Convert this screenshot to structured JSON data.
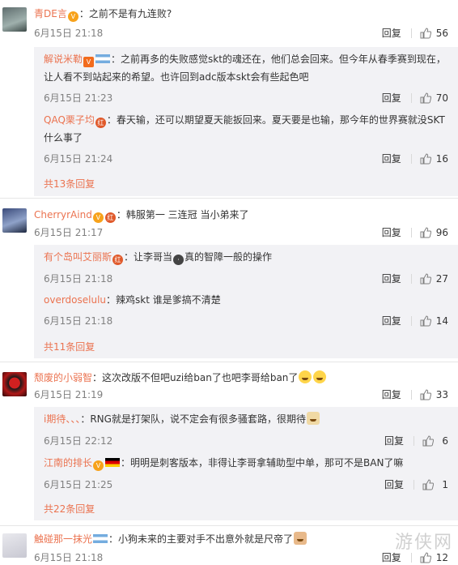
{
  "threads": [
    {
      "user": "青DE言",
      "text": "：之前不是有九连败?",
      "time": "6月15日 21:18",
      "reply_label": "回复",
      "likes": "56",
      "subs": [
        {
          "user": "解说米勒",
          "text": "：之前再多的失败感觉skt的魂还在，他们总会回来。但今年从春季赛到现在，让人看不到站起来的希望。也许回到adc版本skt会有些起色吧",
          "time": "6月15日 21:23",
          "likes": "70"
        },
        {
          "user": "QAQ栗子均",
          "text": "：春天输，还可以期望夏天能扳回来。夏天要是也输，那今年的世界赛就没SKT什么事了",
          "time": "6月15日 21:24",
          "likes": "16"
        }
      ],
      "more": "共13条回复"
    },
    {
      "user": "CherryrAind",
      "text": "：韩服第一 三连冠 当小弟来了",
      "time": "6月15日 21:17",
      "reply_label": "回复",
      "likes": "96",
      "subs": [
        {
          "user": "有个岛叫艾丽斯",
          "text": "：让李哥当",
          "text2": "真的智障一般的操作",
          "time": "6月15日 21:18",
          "likes": "27"
        },
        {
          "user": "overdoselulu",
          "text": "：辣鸡skt 谁是爹搞不清楚",
          "time": "6月15日 21:18",
          "likes": "14"
        }
      ],
      "more": "共11条回复"
    },
    {
      "user": "颓废的小弱智",
      "text": "：这次改版不但吧uzi给ban了也吧李哥给ban了",
      "time": "6月15日 21:19",
      "reply_label": "回复",
      "likes": "33",
      "subs": [
        {
          "user": "i期待、、、",
          "text": "：RNG就是打架队，说不定会有很多骚套路，很期待",
          "time": "6月15日 22:12",
          "likes": "6"
        },
        {
          "user": "江南的排长",
          "text": "：明明是刺客版本，非得让李哥拿辅助型中单，那可不是BAN了嘛",
          "time": "6月15日 21:25",
          "likes": "1"
        }
      ],
      "more": "共22条回复"
    },
    {
      "user": "触碰那一抹光",
      "text": "：小狗未来的主要对手不出意外就是尺帝了",
      "time": "6月15日 21:18",
      "reply_label": "回复",
      "likes": "12",
      "subs": [],
      "more": ""
    }
  ],
  "colors": {
    "username": "#eb7350",
    "sub_background": "#f2f2f5",
    "meta": "#808080"
  },
  "watermark": "游侠网"
}
